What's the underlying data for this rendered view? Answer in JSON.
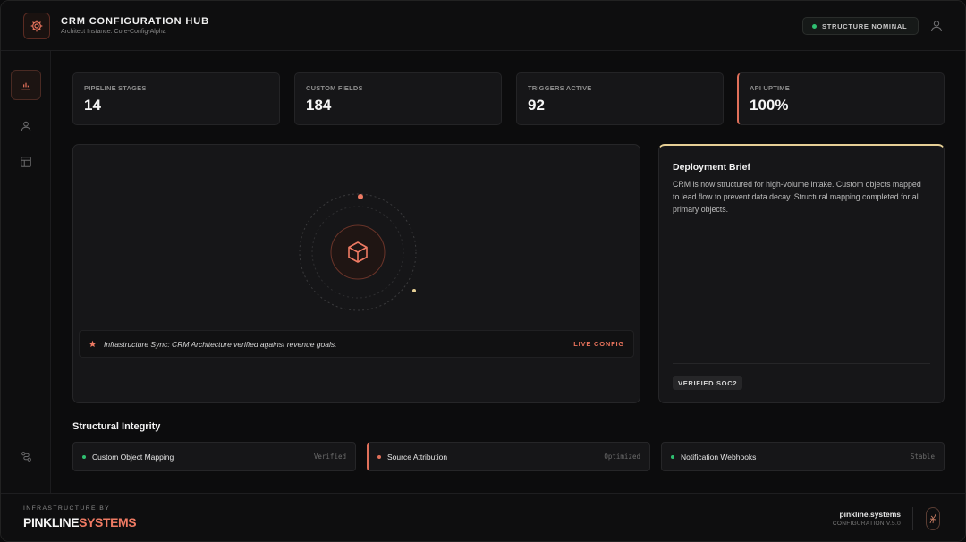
{
  "header": {
    "title": "CRM CONFIGURATION HUB",
    "subtitle": "Architect Instance: Core-Config-Alpha",
    "status": "STRUCTURE NOMINAL"
  },
  "sidebar": {
    "items": [
      {
        "icon": "bar-chart-icon",
        "active": true
      },
      {
        "icon": "user-icon",
        "active": false
      },
      {
        "icon": "layout-icon",
        "active": false
      }
    ],
    "bottom_icon": "route-icon"
  },
  "kpis": [
    {
      "label": "PIPELINE STAGES",
      "value": "14"
    },
    {
      "label": "CUSTOM FIELDS",
      "value": "184"
    },
    {
      "label": "TRIGGERS ACTIVE",
      "value": "92"
    },
    {
      "label": "API UPTIME",
      "value": "100%"
    }
  ],
  "visual": {
    "center_icon": "cube-icon",
    "sync_message": "Infrastructure Sync: CRM Architecture verified against revenue goals.",
    "live_label": "LIVE CONFIG"
  },
  "brief": {
    "title": "Deployment Brief",
    "text": "CRM is now structured for high-volume intake. Custom objects mapped to lead flow to prevent data decay. Structural mapping completed for all primary objects.",
    "badge": "VERIFIED SOC2"
  },
  "integrity": {
    "title": "Structural Integrity",
    "items": [
      {
        "name": "Custom Object Mapping",
        "status": "Verified",
        "dot_color": "#2fbf71"
      },
      {
        "name": "Source Attribution",
        "status": "Optimized",
        "dot_color": "#e0705a"
      },
      {
        "name": "Notification Webhooks",
        "status": "Stable",
        "dot_color": "#2fbf71"
      }
    ]
  },
  "footer": {
    "by_label": "INFRASTRUCTURE BY",
    "brand_part1": "PINKLINE",
    "brand_part2": "SYSTEMS",
    "domain": "pinkline.systems",
    "version": "CONFIGURATION V.5.0"
  },
  "colors": {
    "accent": "#e0705a",
    "ok": "#2fbf71",
    "highlight": "#e6cf95"
  }
}
